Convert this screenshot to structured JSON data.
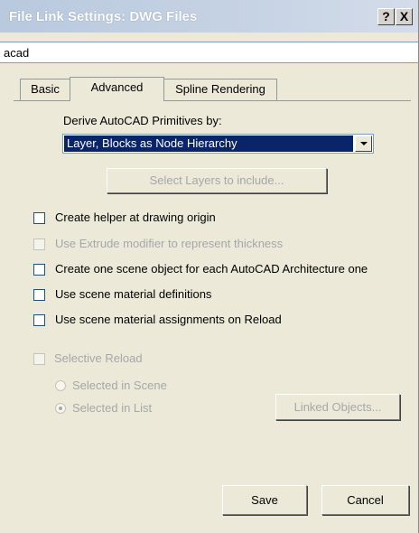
{
  "window": {
    "title": "File Link Settings: DWG Files",
    "help_label": "?",
    "close_label": "X"
  },
  "file": {
    "name": "acad"
  },
  "tabs": [
    {
      "label": "Basic",
      "active": false
    },
    {
      "label": "Advanced",
      "active": true
    },
    {
      "label": "Spline Rendering",
      "active": false
    }
  ],
  "derive": {
    "label": "Derive AutoCAD Primitives by:",
    "selected": "Layer, Blocks as Node Hierarchy"
  },
  "select_layers_button": "Select Layers to include...",
  "options": [
    {
      "label": "Create helper at drawing origin",
      "checked": false,
      "enabled": true
    },
    {
      "label": "Use Extrude modifier to represent thickness",
      "checked": false,
      "enabled": false
    },
    {
      "label": "Create one scene object for each AutoCAD Architecture one",
      "checked": false,
      "enabled": true
    },
    {
      "label": "Use scene material definitions",
      "checked": false,
      "enabled": true
    },
    {
      "label": "Use scene material assignments on Reload",
      "checked": false,
      "enabled": true
    }
  ],
  "selective_reload": {
    "label": "Selective Reload",
    "checked": false,
    "enabled": false,
    "radio_scene": {
      "label": "Selected in Scene",
      "checked": false
    },
    "radio_list": {
      "label": "Selected in List",
      "checked": true
    },
    "linked_objects_button": "Linked Objects..."
  },
  "footer": {
    "save_label": "Save",
    "cancel_label": "Cancel"
  },
  "colors": {
    "selection_highlight": "#0a246a",
    "dialog_background": "#ece9d8",
    "disabled_text": "#a7a6aa"
  }
}
